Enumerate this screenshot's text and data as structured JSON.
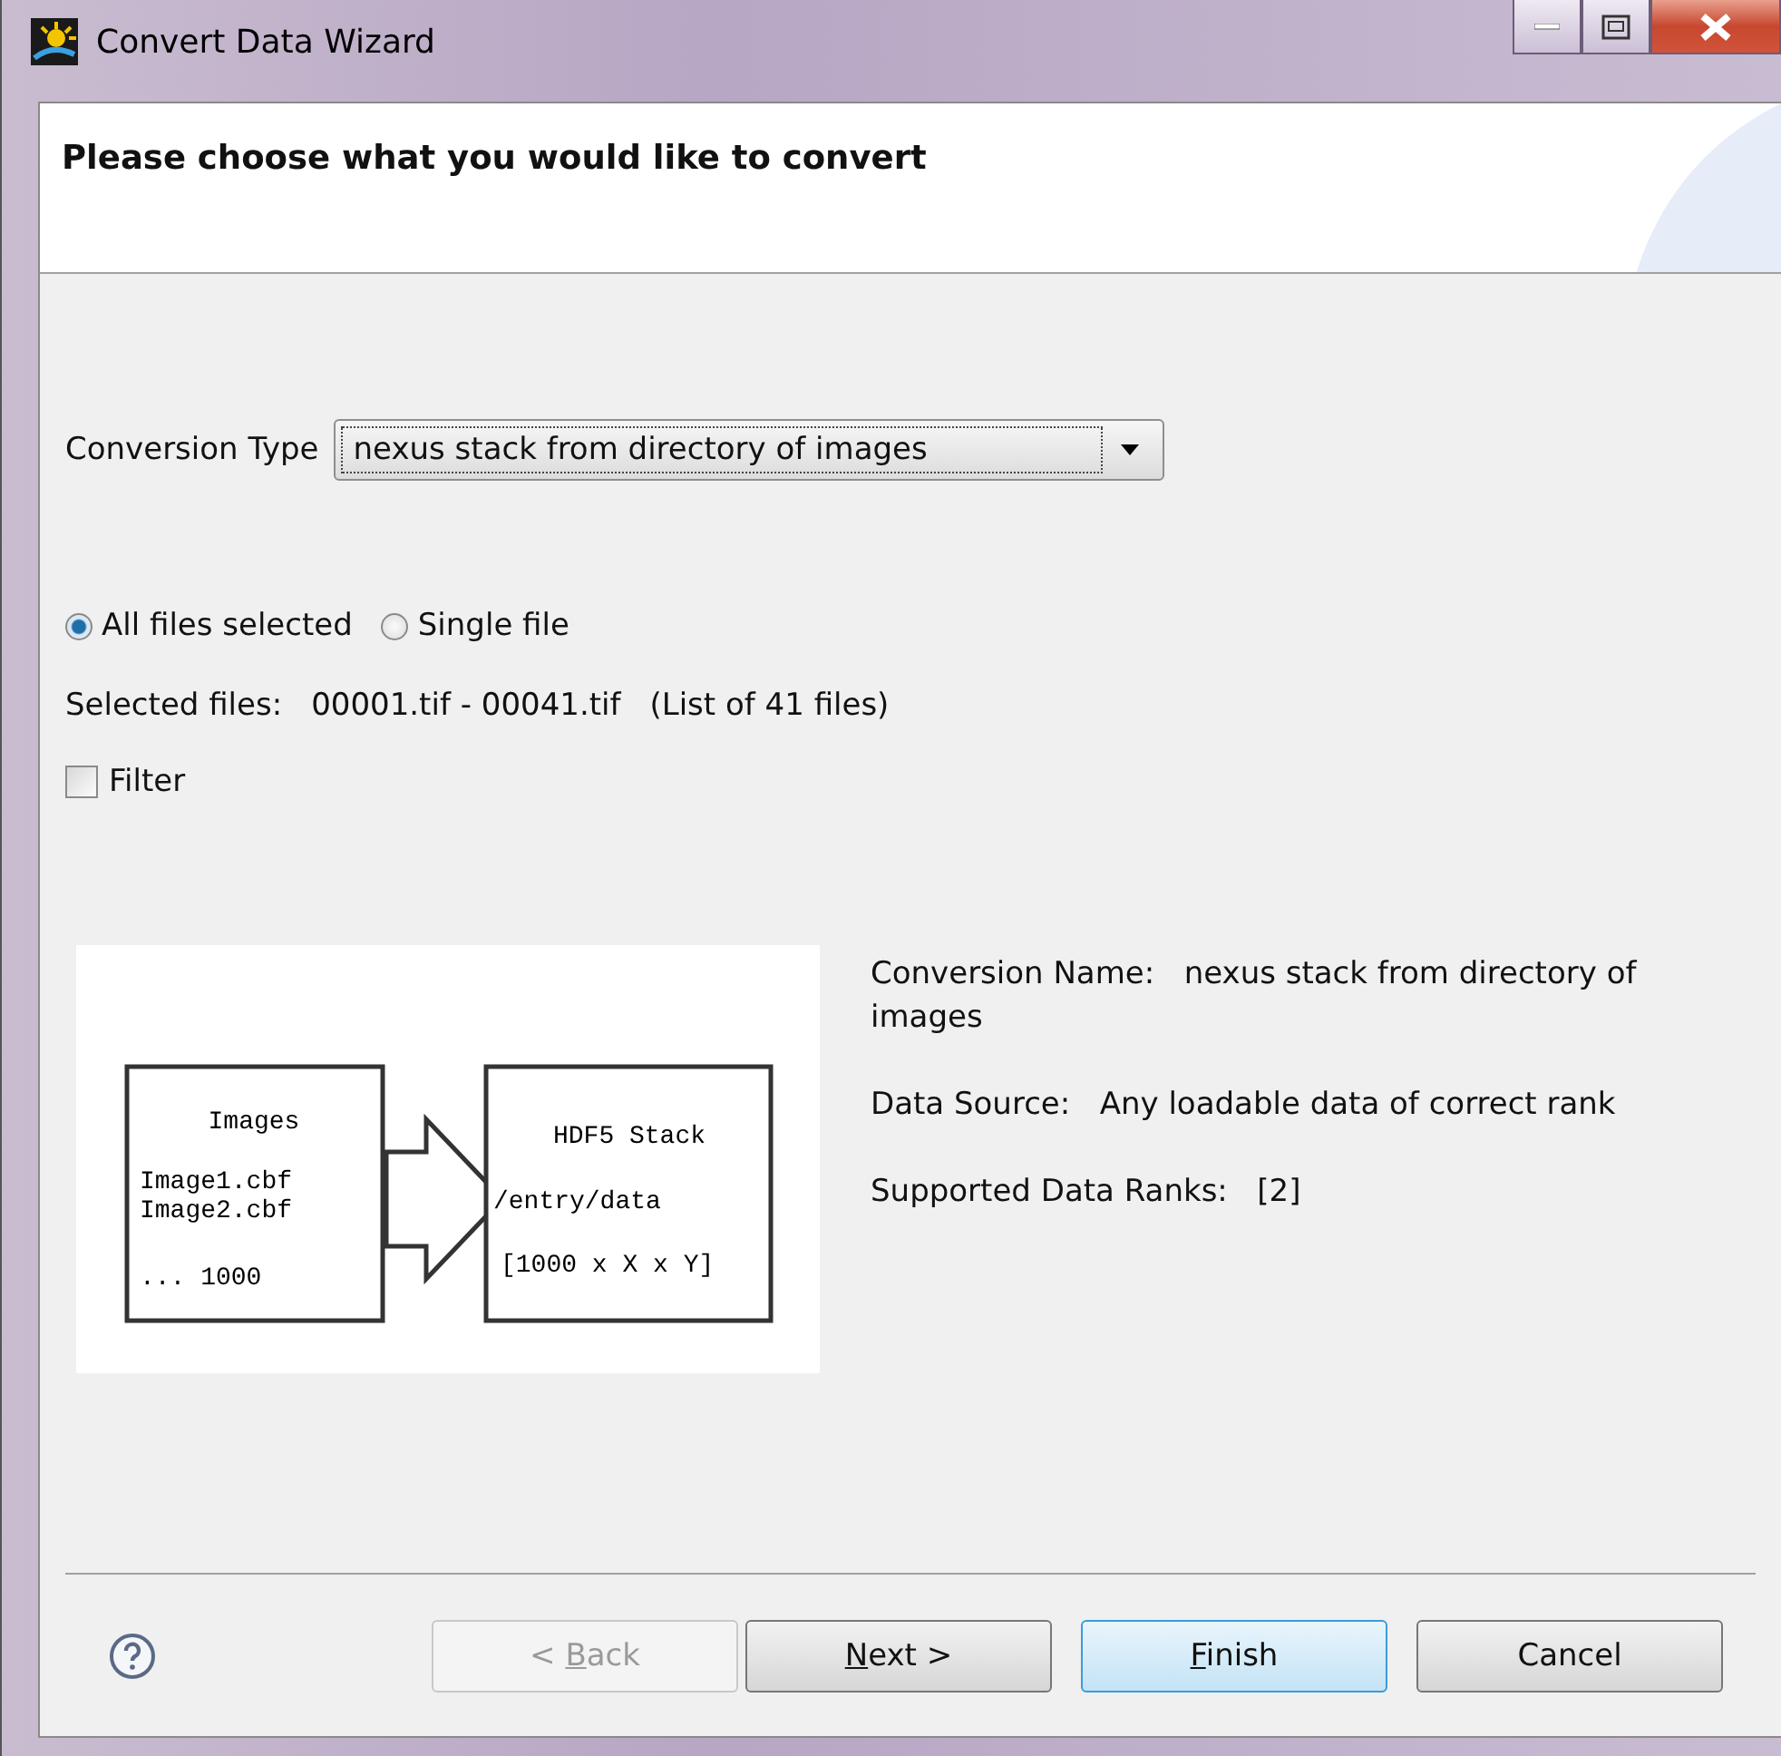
{
  "window": {
    "title": "Convert Data Wizard"
  },
  "header": {
    "title": "Please choose what you would like to convert"
  },
  "conversion_type": {
    "label": "Conversion Type",
    "value": "nexus stack from directory of images"
  },
  "file_mode": [
    {
      "label": "All files selected",
      "selected": true
    },
    {
      "label": "Single file",
      "selected": false
    }
  ],
  "selected_files": {
    "label": "Selected files:",
    "range": "00001.tif - 00041.tif",
    "count": "(List of 41 files)"
  },
  "filter": {
    "label": "Filter",
    "checked": false
  },
  "diagram": {
    "source_title": "Images",
    "source_lines": [
      "Image1.cbf",
      "Image2.cbf"
    ],
    "source_more": "... 1000",
    "target_title": "HDF5 Stack",
    "target_path": "/entry/data",
    "target_shape": "[1000 x X x Y]"
  },
  "info": [
    {
      "label": "Conversion Name:",
      "value": "nexus stack from directory of images"
    },
    {
      "label": "Data Source:",
      "value": "Any loadable data of correct rank"
    },
    {
      "label": "Supported Data Ranks:",
      "value": "[2]"
    }
  ],
  "buttons": [
    {
      "before": "< ",
      "key": "B",
      "after": "ack",
      "disabled": true,
      "default": false
    },
    {
      "key": "N",
      "after": "ext >",
      "disabled": false,
      "default": false
    },
    {
      "key": "F",
      "after": "inish",
      "disabled": false,
      "default": true
    },
    {
      "before": "Cancel",
      "disabled": false,
      "default": false
    }
  ]
}
